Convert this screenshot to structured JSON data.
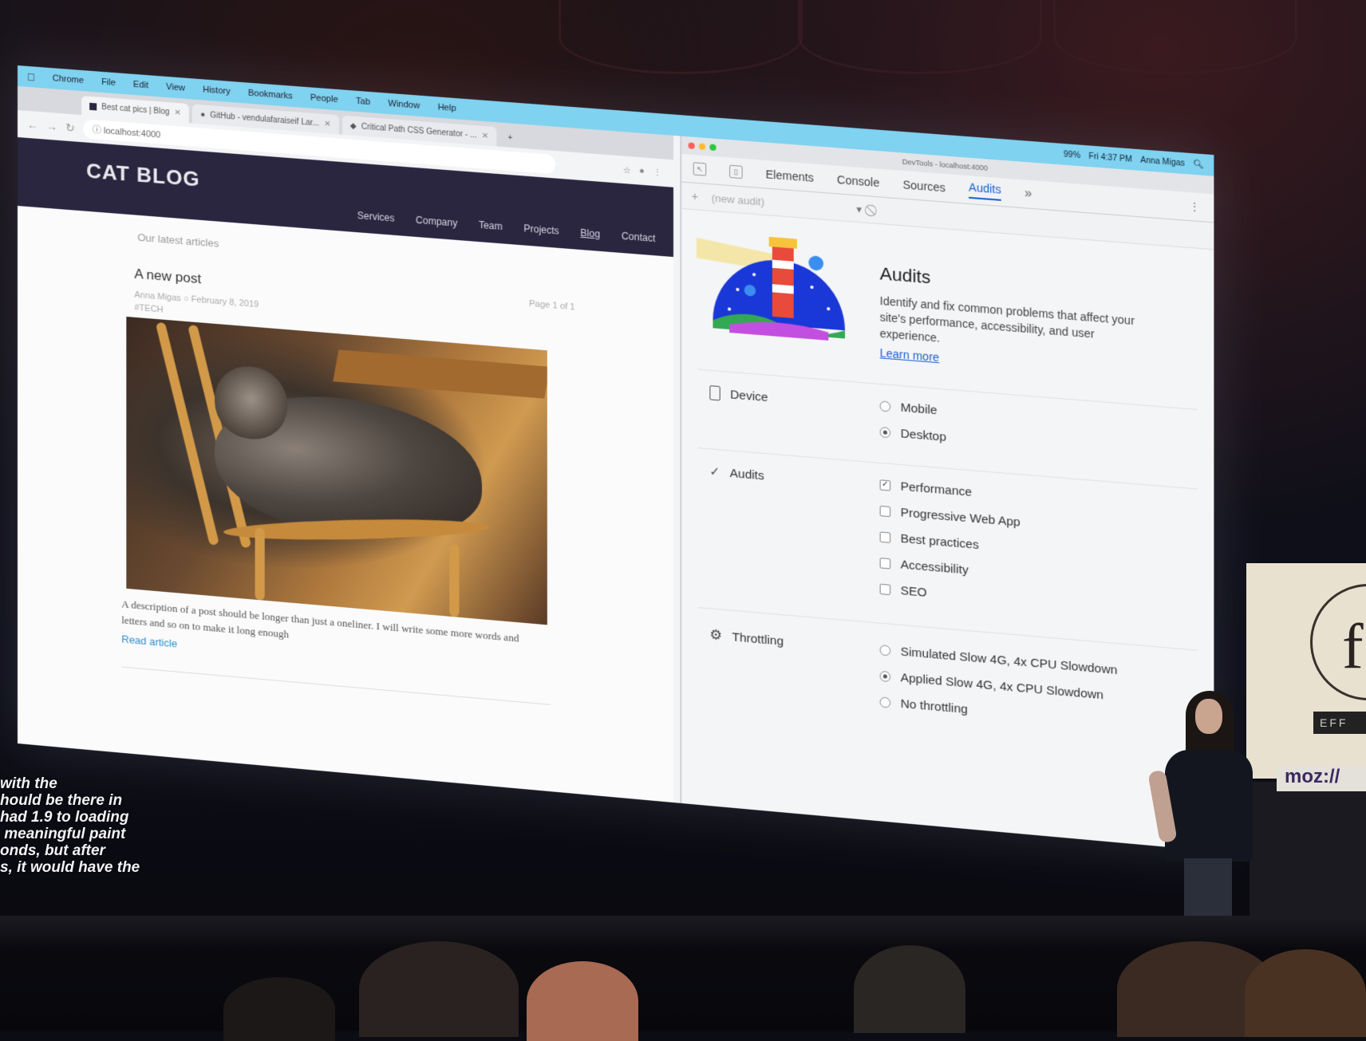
{
  "mac_menu": {
    "apple": "",
    "items": [
      "Chrome",
      "File",
      "Edit",
      "View",
      "History",
      "Bookmarks",
      "People",
      "Tab",
      "Window",
      "Help"
    ],
    "status": [
      "99%",
      "Fri 4:37 PM",
      "Anna Migas"
    ]
  },
  "browser": {
    "tabs": [
      {
        "title": "Best cat pics | Blog",
        "active": true
      },
      {
        "title": "GitHub - vendulafaraiseif Lar...",
        "active": false
      },
      {
        "title": "Critical Path CSS Generator - ...",
        "active": false
      }
    ],
    "url": "localhost:4000"
  },
  "site": {
    "logo": "CAT BLOG",
    "nav": [
      "Services",
      "Company",
      "Team",
      "Projects",
      "Blog",
      "Contact"
    ],
    "active_nav": "Blog",
    "latest": "Our latest articles",
    "post": {
      "title": "A new post",
      "page": "Page 1 of 1",
      "author": "Anna Migas",
      "date": "February 8, 2019",
      "tag": "#TECH",
      "excerpt": "A description of a post should be longer than just a oneliner. I will write some more words and letters and so on to make it long enough",
      "read_more": "Read article"
    }
  },
  "devtools": {
    "window_title": "DevTools - localhost:4000",
    "tabs": [
      "Elements",
      "Console",
      "Sources",
      "Audits"
    ],
    "selected_tab": "Audits",
    "audit_select": "(new audit)",
    "hero": {
      "title": "Audits",
      "description": "Identify and fix common problems that affect your site's performance, accessibility, and user experience.",
      "learn_more": "Learn more"
    },
    "device": {
      "label": "Device",
      "options": [
        {
          "label": "Mobile",
          "checked": false
        },
        {
          "label": "Desktop",
          "checked": true
        }
      ]
    },
    "audits": {
      "label": "Audits",
      "options": [
        {
          "label": "Performance",
          "checked": true
        },
        {
          "label": "Progressive Web App",
          "checked": false
        },
        {
          "label": "Best practices",
          "checked": false
        },
        {
          "label": "Accessibility",
          "checked": false
        },
        {
          "label": "SEO",
          "checked": false
        }
      ]
    },
    "throttling": {
      "label": "Throttling",
      "options": [
        {
          "label": "Simulated Slow 4G, 4x CPU Slowdown",
          "checked": false
        },
        {
          "label": "Applied Slow 4G, 4x CPU Slowdown",
          "checked": true
        },
        {
          "label": "No throttling",
          "checked": false
        }
      ]
    }
  },
  "captions": [
    "with the",
    "hould be there in",
    "had 1.9 to loading",
    " meaningful paint",
    "onds, but after",
    "s, it would have the"
  ],
  "podium_text": "moz://",
  "banner_text": "EFF"
}
